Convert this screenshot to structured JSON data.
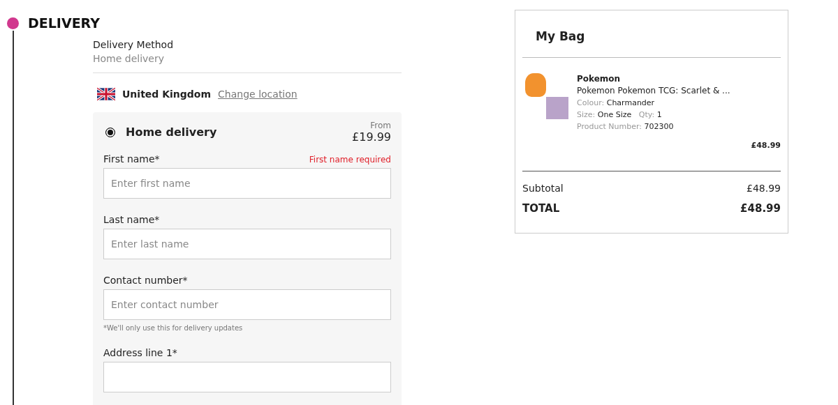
{
  "section": {
    "title": "DELIVERY"
  },
  "delivery_method": {
    "label": "Delivery Method",
    "value": "Home delivery"
  },
  "location": {
    "country": "United Kingdom",
    "link": "Change location"
  },
  "option": {
    "label": "Home delivery",
    "selected": true,
    "price_label": "From",
    "price": "£19.99"
  },
  "fields": [
    {
      "label": "First name*",
      "placeholder": "Enter first name",
      "error": "First name required"
    },
    {
      "label": "Last name*",
      "placeholder": "Enter last name"
    },
    {
      "label": "Contact number*",
      "placeholder": "Enter contact number",
      "hint": "*We'll only use this for delivery updates"
    },
    {
      "label": "Address line 1*"
    }
  ],
  "bag": {
    "title": "My Bag",
    "items": [
      {
        "brand": "Pokemon",
        "name": "Pokemon Pokemon TCG: Scarlet & ...",
        "colour_label": "Colour:",
        "colour": "Charmander",
        "size_label": "Size:",
        "size": "One Size",
        "qty_label": "Qty:",
        "qty": "1",
        "number_label": "Product Number:",
        "number": "702300",
        "price": "£48.99"
      }
    ],
    "subtotal_label": "Subtotal",
    "subtotal": "£48.99",
    "total_label": "TOTAL",
    "total": "£48.99"
  }
}
